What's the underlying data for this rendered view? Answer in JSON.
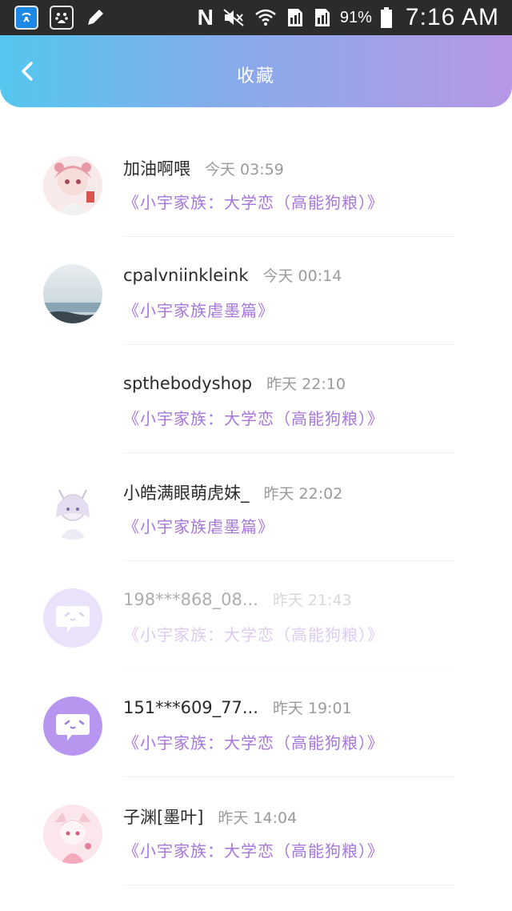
{
  "status_bar": {
    "battery_percent": "91%",
    "time": "7:16 AM",
    "network_label": "N",
    "icons": [
      "wifi-hotspot-app-icon",
      "baidu-app-icon",
      "pencil-icon",
      "nfc-icon",
      "mute-icon",
      "wifi-icon",
      "sim-signal-icon",
      "sim-signal-icon",
      "battery-icon"
    ]
  },
  "header": {
    "title": "收藏",
    "back_icon": "chevron-left-icon",
    "gradient": [
      "#54c6ef",
      "#b798e6"
    ]
  },
  "accent_color": "#a776dd",
  "items": [
    {
      "name": "加油啊喂",
      "time": "今天 03:59",
      "book": "《小宇家族：大学恋（高能狗粮）》",
      "avatar": "anime-girl-avatar"
    },
    {
      "name": "cpalvniinkleink",
      "time": "今天 00:14",
      "book": "《小宇家族虐墨篇》",
      "avatar": "sea-photo-avatar"
    },
    {
      "name": "spthebodyshop",
      "time": "昨天 22:10",
      "book": "《小宇家族：大学恋（高能狗粮）》",
      "avatar": "blank-avatar"
    },
    {
      "name": "小皓满眼萌虎妹_",
      "time": "昨天 22:02",
      "book": "《小宇家族虐墨篇》",
      "avatar": "anime-sketch-avatar"
    },
    {
      "name": "198***868_08...",
      "time": "昨天 21:43",
      "book": "《小宇家族：大学恋（高能狗粮）》",
      "avatar": "default-chat-bubble-avatar"
    },
    {
      "name": "151***609_77...",
      "time": "昨天 19:01",
      "book": "《小宇家族：大学恋（高能狗粮）》",
      "avatar": "default-chat-bubble-avatar"
    },
    {
      "name": "子渊[墨叶]",
      "time": "昨天 14:04",
      "book": "《小宇家族：大学恋（高能狗粮）》",
      "avatar": "anime-girl-pink-avatar"
    }
  ]
}
